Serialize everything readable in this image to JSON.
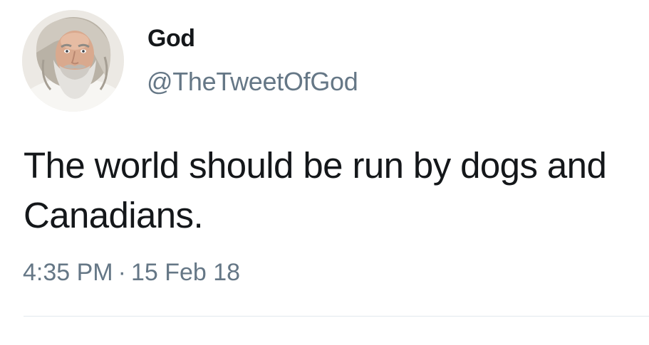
{
  "tweet": {
    "author": {
      "display_name": "God",
      "handle": "@TheTweetOfGod",
      "avatar_icon": "bearded-man-avatar"
    },
    "text": "The world should be run by dogs and Canadians.",
    "time": "4:35 PM",
    "separator": "·",
    "date": "15 Feb 18"
  },
  "colors": {
    "text_primary": "#14171a",
    "text_secondary": "#657786",
    "divider": "#e1e8ed",
    "background": "#ffffff"
  }
}
